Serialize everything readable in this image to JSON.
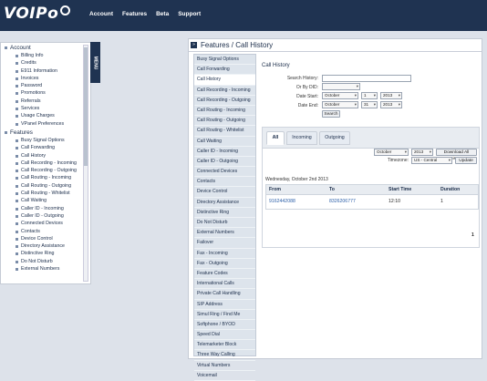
{
  "logo": {
    "text": "VOIPo"
  },
  "topnav": [
    "Account",
    "Features",
    "Beta",
    "Support"
  ],
  "sidebar": {
    "menu_tab_label": "MENU",
    "sections": [
      {
        "label": "Account",
        "items": [
          "Billing Info",
          "Credits",
          "E911 Information",
          "Invoices",
          "Password",
          "Promotions",
          "Referrals",
          "Services",
          "Usage Charges",
          "VPanel Preferences"
        ]
      },
      {
        "label": "Features",
        "items": [
          "Busy Signal Options",
          "Call Forwarding",
          "Call History",
          "Call Recording - Incoming",
          "Call Recording - Outgoing",
          "Call Routing - Incoming",
          "Call Routing - Outgoing",
          "Call Routing - Whitelist",
          "Call Waiting",
          "Caller ID - Incoming",
          "Caller ID - Outgoing",
          "Connected Devices",
          "Contacts",
          "Device Control",
          "Directory Assistance",
          "Distinctive Ring",
          "Do Not Disturb",
          "External Numbers"
        ]
      }
    ]
  },
  "main": {
    "title": "Features / Call History",
    "nav_items": [
      "Busy Signal Options",
      "Call Forwarding",
      "Call History",
      "Call Recording - Incoming",
      "Call Recording - Outgoing",
      "Call Routing - Incoming",
      "Call Routing - Outgoing",
      "Call Routing - Whitelist",
      "Call Waiting",
      "Caller ID - Incoming",
      "Caller ID - Outgoing",
      "Connected Devices",
      "Contacts",
      "Device Control",
      "Directory Assistance",
      "Distinctive Ring",
      "Do Not Disturb",
      "External Numbers",
      "Failover",
      "Fax - Incoming",
      "Fax - Outgoing",
      "Feature Codes",
      "International Calls",
      "Private Call Handling",
      "SIP Address",
      "Simul Ring / Find Me",
      "Softphone / BYOD",
      "Speed Dial",
      "Telemarketer Block",
      "Three Way Calling",
      "Virtual Numbers",
      "Voicemail"
    ],
    "active_nav_index": 2,
    "section_title": "Call History",
    "form": {
      "search_label": "Search History:",
      "search_value": "",
      "did_label": "Or By DID:",
      "did_value": "",
      "date_start_label": "Date Start:",
      "date_start": {
        "month": "October",
        "day": "1",
        "year": "2013"
      },
      "date_end_label": "Date End:",
      "date_end": {
        "month": "October",
        "day": "31",
        "year": "2013"
      },
      "search_button": "Search"
    },
    "tabs": [
      "All",
      "Incoming",
      "Outgoing"
    ],
    "active_tab": 0,
    "filters": {
      "month": "October",
      "year": "2013",
      "download_button": "Download All History",
      "timezone_label": "Timezone:",
      "timezone": "US - Central",
      "update_button": "Update"
    },
    "date_caption": "Wednesday, October 2nd 2013",
    "table": {
      "columns": [
        "From",
        "To",
        "Start Time",
        "Duration"
      ],
      "rows": [
        [
          "9162442088",
          "8326206777",
          "12:10",
          "1"
        ]
      ]
    },
    "page": "1"
  }
}
